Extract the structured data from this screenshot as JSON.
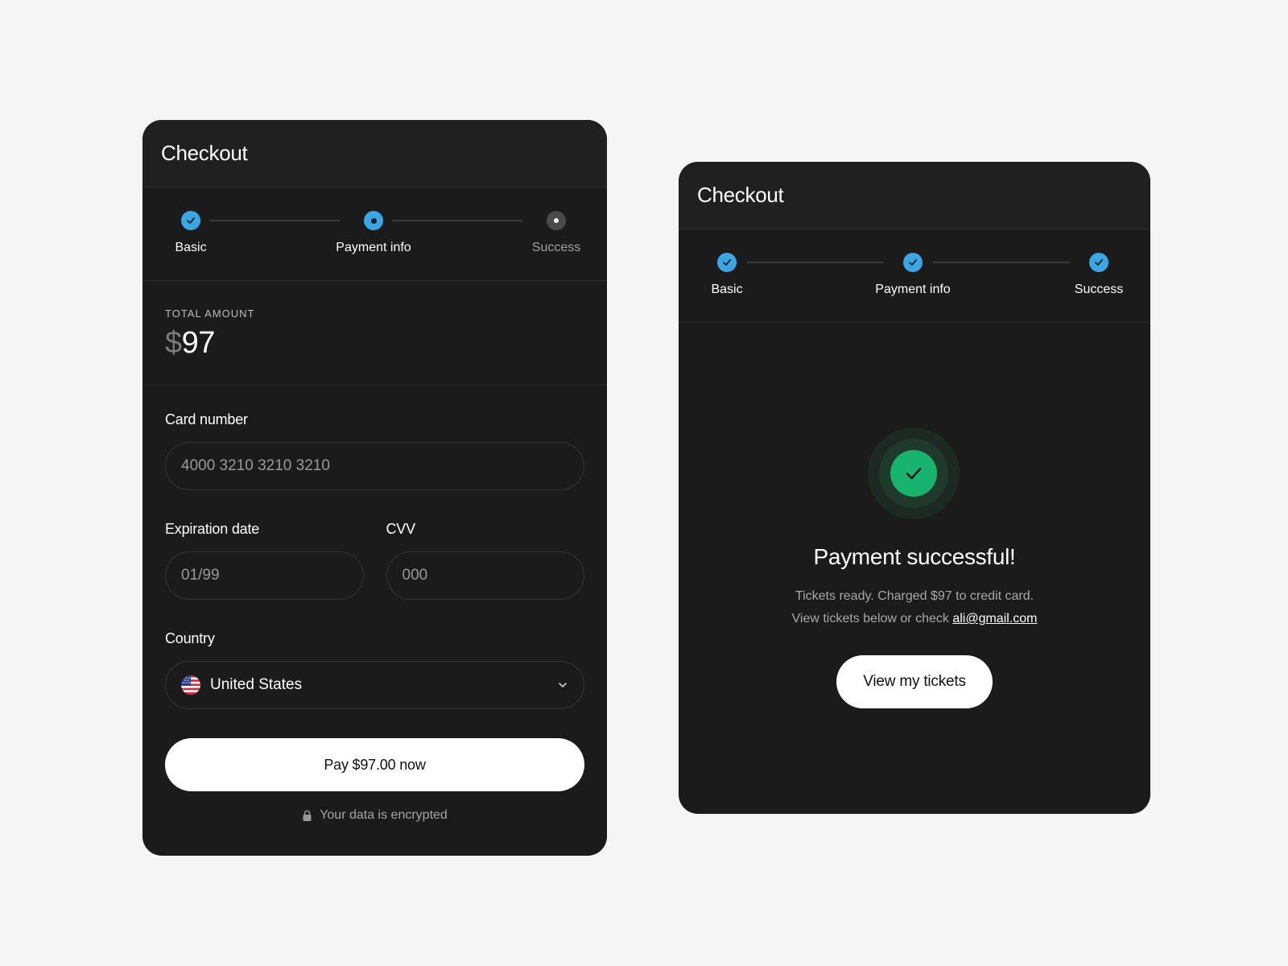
{
  "checkout_form": {
    "title": "Checkout",
    "steps": [
      {
        "label": "Basic",
        "state": "done"
      },
      {
        "label": "Payment info",
        "state": "current"
      },
      {
        "label": "Success",
        "state": "pending"
      }
    ],
    "total_label": "TOTAL AMOUNT",
    "total_currency": "$",
    "total_value": "97",
    "card_number": {
      "label": "Card number",
      "placeholder": "4000 3210 3210 3210"
    },
    "expiration": {
      "label": "Expiration date",
      "placeholder": "01/99"
    },
    "cvv": {
      "label": "CVV",
      "placeholder": "000"
    },
    "country": {
      "label": "Country",
      "value": "United States",
      "flag_icon": "us-flag-icon"
    },
    "pay_button": "Pay $97.00 now",
    "secure_note": "Your data is encrypted"
  },
  "checkout_success": {
    "title": "Checkout",
    "steps": [
      {
        "label": "Basic",
        "state": "done"
      },
      {
        "label": "Payment info",
        "state": "done"
      },
      {
        "label": "Success",
        "state": "done"
      }
    ],
    "heading": "Payment successful!",
    "line1": "Tickets ready. Charged $97 to credit card.",
    "line2_prefix": "View tickets below or check ",
    "email": "ali@gmail.com",
    "button": "View my tickets"
  },
  "colors": {
    "accent": "#3aa7e4",
    "success": "#18b36f",
    "card_bg": "#1b1b1b",
    "page_bg": "#f5f5f5"
  }
}
